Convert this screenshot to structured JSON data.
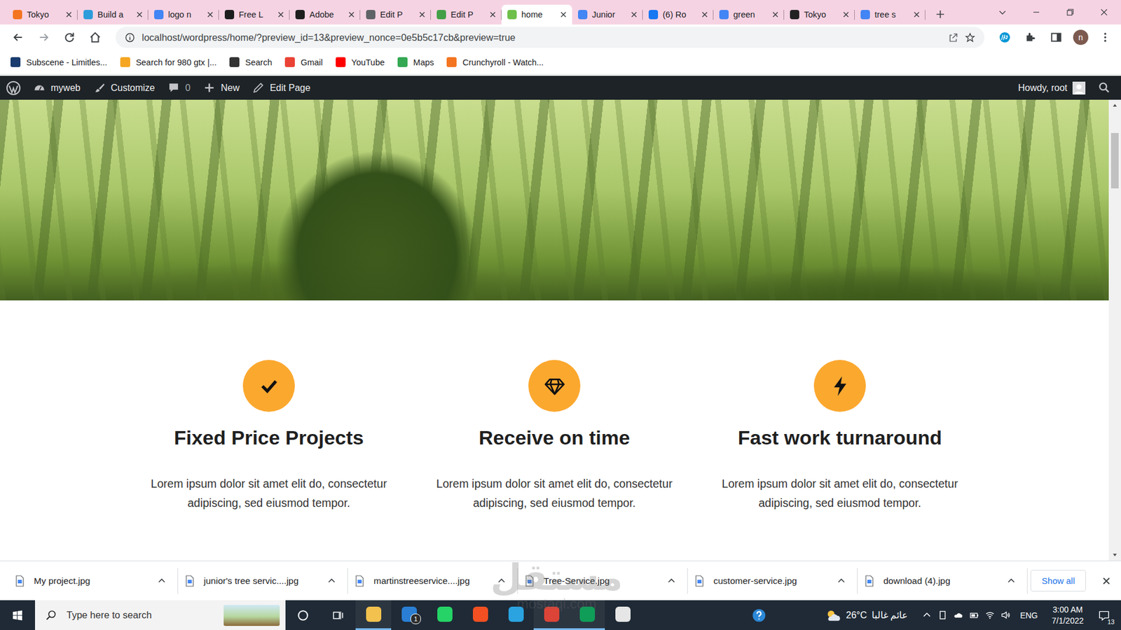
{
  "browser": {
    "tabs": [
      {
        "label": "Tokyo",
        "selected": false,
        "color": "#f47521"
      },
      {
        "label": "Build a",
        "selected": false,
        "color": "#2d9cdb"
      },
      {
        "label": "logo n",
        "selected": false,
        "color": "#4285f4"
      },
      {
        "label": "Free L",
        "selected": false,
        "color": "#1e1e1e"
      },
      {
        "label": "Adobe",
        "selected": false,
        "color": "#1e1e1e"
      },
      {
        "label": "Edit P",
        "selected": false,
        "color": "#5f6368"
      },
      {
        "label": "Edit P",
        "selected": false,
        "color": "#43a047"
      },
      {
        "label": "home",
        "selected": true,
        "color": "#6ec04a"
      },
      {
        "label": "Junior",
        "selected": false,
        "color": "#4285f4"
      },
      {
        "label": "(6) Ro",
        "selected": false,
        "color": "#1877f2"
      },
      {
        "label": "green",
        "selected": false,
        "color": "#4285f4"
      },
      {
        "label": "Tokyo",
        "selected": false,
        "color": "#222222"
      },
      {
        "label": "tree s",
        "selected": false,
        "color": "#4285f4"
      }
    ],
    "address": "localhost/wordpress/home/?preview_id=13&preview_nonce=0e5b5c17cb&preview=true",
    "profile": "n",
    "bookmarks": [
      {
        "label": "Subscene - Limitles...",
        "color": "#1a3c6e"
      },
      {
        "label": "Search for 980 gtx |...",
        "color": "#f5a623"
      },
      {
        "label": "Search",
        "color": "#333333"
      },
      {
        "label": "Gmail",
        "color": "#ea4335"
      },
      {
        "label": "YouTube",
        "color": "#ff0000"
      },
      {
        "label": "Maps",
        "color": "#34a853"
      },
      {
        "label": "Crunchyroll - Watch...",
        "color": "#f47521"
      }
    ]
  },
  "admin_bar": {
    "site": "myweb",
    "customize": "Customize",
    "comments": "0",
    "new": "New",
    "edit": "Edit Page",
    "howdy": "Howdy, root"
  },
  "features": [
    {
      "kind": "check",
      "title": "Fixed Price Projects",
      "text": "Lorem ipsum dolor sit amet elit do, consectetur adipiscing, sed eiusmod tempor."
    },
    {
      "kind": "diamond",
      "title": "Receive on time",
      "text": "Lorem ipsum dolor sit amet elit do, consectetur adipiscing, sed eiusmod tempor."
    },
    {
      "kind": "bolt",
      "title": "Fast work turnaround",
      "text": "Lorem ipsum dolor sit amet elit do, consectetur adipiscing, sed eiusmod tempor."
    }
  ],
  "downloads": {
    "files": [
      "My project.jpg",
      "junior's tree servic....jpg",
      "martinstreeservice....jpg",
      "Tree-Service.jpg",
      "customer-service.jpg",
      "download (4).jpg"
    ],
    "show_all": "Show all"
  },
  "watermark": {
    "text": "مستقل",
    "url": "mostaql.com"
  },
  "taskbar": {
    "search": "Type here to search",
    "apps": [
      {
        "name": "explorer",
        "color": "#f2c14e",
        "running": true,
        "badge": ""
      },
      {
        "name": "mail",
        "color": "#2a7fd4",
        "running": false,
        "badge": "1"
      },
      {
        "name": "whatsapp",
        "color": "#25d366",
        "running": false,
        "badge": ""
      },
      {
        "name": "store",
        "color": "#f25022",
        "running": false,
        "badge": ""
      },
      {
        "name": "telegram",
        "color": "#2aa3e0",
        "running": false,
        "badge": ""
      },
      {
        "name": "chrome",
        "color": "#db4437",
        "running": true,
        "badge": ""
      },
      {
        "name": "chrome-profile",
        "color": "#0f9d58",
        "running": true,
        "badge": ""
      },
      {
        "name": "github",
        "color": "#e6e6e6",
        "running": false,
        "badge": ""
      }
    ],
    "temperature": "26°C",
    "weather": "عائم غالبا",
    "language": "ENG",
    "time": "3:00 AM",
    "date": "7/1/2022",
    "notifications": "13"
  }
}
